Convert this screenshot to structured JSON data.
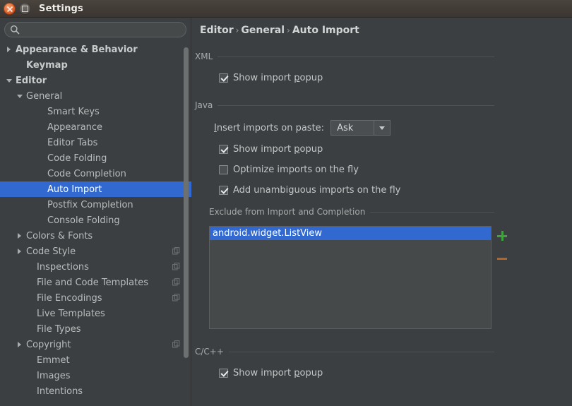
{
  "window": {
    "title": "Settings",
    "close_icon": "close-icon",
    "maximize_icon": "maximize-icon"
  },
  "search": {
    "value": "",
    "placeholder": "",
    "icon": "search-icon"
  },
  "sidebar": {
    "items": [
      {
        "label": "Appearance & Behavior",
        "indent": 0,
        "twisty": "collapsed",
        "bold": true,
        "selected": false,
        "badge": false
      },
      {
        "label": "Keymap",
        "indent": 1,
        "twisty": "none",
        "bold": true,
        "selected": false,
        "badge": false
      },
      {
        "label": "Editor",
        "indent": 0,
        "twisty": "expanded",
        "bold": true,
        "selected": false,
        "badge": false
      },
      {
        "label": "General",
        "indent": 1,
        "twisty": "expanded",
        "bold": false,
        "selected": false,
        "badge": false
      },
      {
        "label": "Smart Keys",
        "indent": 3,
        "twisty": "none",
        "bold": false,
        "selected": false,
        "badge": false
      },
      {
        "label": "Appearance",
        "indent": 3,
        "twisty": "none",
        "bold": false,
        "selected": false,
        "badge": false
      },
      {
        "label": "Editor Tabs",
        "indent": 3,
        "twisty": "none",
        "bold": false,
        "selected": false,
        "badge": false
      },
      {
        "label": "Code Folding",
        "indent": 3,
        "twisty": "none",
        "bold": false,
        "selected": false,
        "badge": false
      },
      {
        "label": "Code Completion",
        "indent": 3,
        "twisty": "none",
        "bold": false,
        "selected": false,
        "badge": false
      },
      {
        "label": "Auto Import",
        "indent": 3,
        "twisty": "none",
        "bold": false,
        "selected": true,
        "badge": false
      },
      {
        "label": "Postfix Completion",
        "indent": 3,
        "twisty": "none",
        "bold": false,
        "selected": false,
        "badge": false
      },
      {
        "label": "Console Folding",
        "indent": 3,
        "twisty": "none",
        "bold": false,
        "selected": false,
        "badge": false
      },
      {
        "label": "Colors & Fonts",
        "indent": 1,
        "twisty": "collapsed",
        "bold": false,
        "selected": false,
        "badge": false
      },
      {
        "label": "Code Style",
        "indent": 1,
        "twisty": "collapsed",
        "bold": false,
        "selected": false,
        "badge": true
      },
      {
        "label": "Inspections",
        "indent": 2,
        "twisty": "none",
        "bold": false,
        "selected": false,
        "badge": true
      },
      {
        "label": "File and Code Templates",
        "indent": 2,
        "twisty": "none",
        "bold": false,
        "selected": false,
        "badge": true
      },
      {
        "label": "File Encodings",
        "indent": 2,
        "twisty": "none",
        "bold": false,
        "selected": false,
        "badge": true
      },
      {
        "label": "Live Templates",
        "indent": 2,
        "twisty": "none",
        "bold": false,
        "selected": false,
        "badge": false
      },
      {
        "label": "File Types",
        "indent": 2,
        "twisty": "none",
        "bold": false,
        "selected": false,
        "badge": false
      },
      {
        "label": "Copyright",
        "indent": 1,
        "twisty": "collapsed",
        "bold": false,
        "selected": false,
        "badge": true
      },
      {
        "label": "Emmet",
        "indent": 2,
        "twisty": "none",
        "bold": false,
        "selected": false,
        "badge": false
      },
      {
        "label": "Images",
        "indent": 2,
        "twisty": "none",
        "bold": false,
        "selected": false,
        "badge": false
      },
      {
        "label": "Intentions",
        "indent": 2,
        "twisty": "none",
        "bold": false,
        "selected": false,
        "badge": false
      }
    ]
  },
  "breadcrumb": {
    "part1": "Editor",
    "sep1": "›",
    "part2": "General",
    "sep2": "›",
    "part3": "Auto Import"
  },
  "xml_section": {
    "title": "XML",
    "show_import_popup": {
      "label": "Show import popup",
      "checked": true
    }
  },
  "java_section": {
    "title": "Java",
    "insert_imports_label": "Insert imports on paste:",
    "insert_imports_value": "Ask",
    "show_import_popup": {
      "label": "Show import popup",
      "checked": true
    },
    "optimize_imports": {
      "label": "Optimize imports on the fly",
      "checked": false
    },
    "add_unambiguous": {
      "label": "Add unambiguous imports on the fly",
      "checked": true
    }
  },
  "exclude_section": {
    "title": "Exclude from Import and Completion",
    "items": [
      {
        "value": "android.widget.ListView",
        "selected": true
      }
    ],
    "add_button": "add-button",
    "remove_button": "remove-button"
  },
  "cpp_section": {
    "title": "C/C++",
    "show_import_popup": {
      "label": "Show import popup",
      "checked": true
    }
  },
  "colors": {
    "background": "#3c3f41",
    "selection": "#3169d0",
    "titlebar": "#433d38",
    "add_green": "#3fa23f",
    "remove_orange": "#b5651f"
  }
}
